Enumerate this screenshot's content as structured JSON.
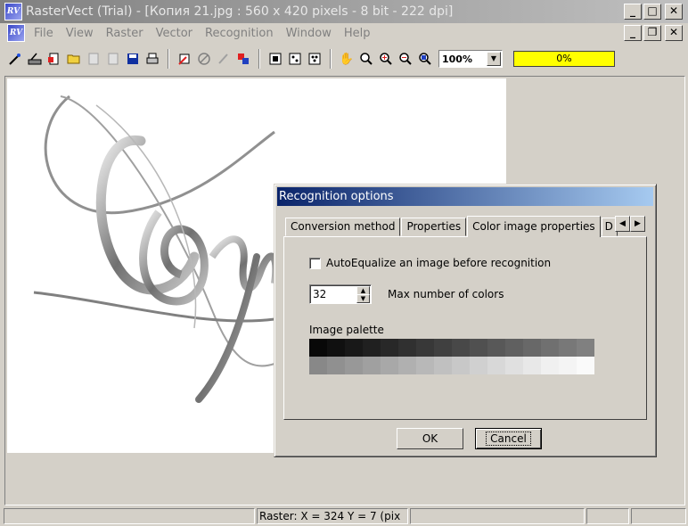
{
  "window": {
    "title": "RasterVect (Trial) - [Копия 21.jpg : 560 x 420 pixels - 8 bit - 222 dpi]"
  },
  "app_icon_text": "RV",
  "menu": [
    "File",
    "View",
    "Raster",
    "Vector",
    "Recognition",
    "Window",
    "Help"
  ],
  "toolbar": {
    "zoom": "100%",
    "progress": "0%"
  },
  "dialog": {
    "title": "Recognition options",
    "tabs": [
      "Conversion method",
      "Properties",
      "Color image properties",
      "D"
    ],
    "checkbox_label": "AutoEqualize an image before recognition",
    "colors_value": "32",
    "colors_label": "Max number of colors",
    "palette_label": "Image palette",
    "palette": [
      "#080808",
      "#101010",
      "#181818",
      "#202020",
      "#282828",
      "#303030",
      "#383838",
      "#404040",
      "#484848",
      "#505050",
      "#585858",
      "#606060",
      "#686868",
      "#707070",
      "#787878",
      "#808080",
      "#888888",
      "#909090",
      "#989898",
      "#a0a0a0",
      "#a8a8a8",
      "#b0b0b0",
      "#b8b8b8",
      "#c0c0c0",
      "#c8c8c8",
      "#d0d0d0",
      "#d8d8d8",
      "#e0e0e0",
      "#e8e8e8",
      "#f0f0f0",
      "#f4f4f4",
      "#fafafa"
    ],
    "ok": "OK",
    "cancel": "Cancel"
  },
  "status": {
    "coords": "Raster:  X = 324   Y = 7 (pix"
  }
}
